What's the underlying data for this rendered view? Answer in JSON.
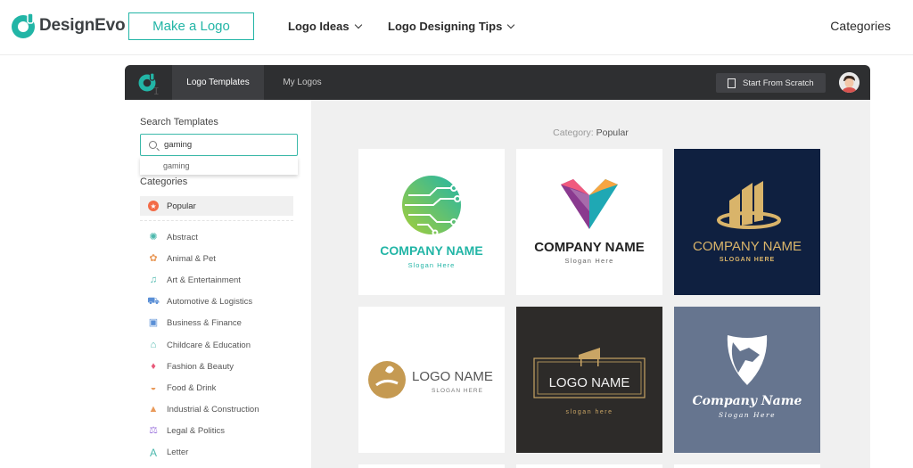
{
  "site": {
    "brand_name": "DesignEvo",
    "make_logo_label": "Make a Logo",
    "nav": [
      {
        "label": "Logo Ideas"
      },
      {
        "label": "Logo Designing Tips"
      }
    ],
    "categories_label": "Categories",
    "colors": {
      "accent": "#22b5a6"
    }
  },
  "app": {
    "tabs": [
      {
        "label": "Logo Templates",
        "active": true
      },
      {
        "label": "My Logos",
        "active": false
      }
    ],
    "scratch_label": "Start From Scratch",
    "avatar_icon": "user-avatar"
  },
  "sidebar": {
    "search_title": "Search Templates",
    "search_value": "gaming",
    "suggestion": "gaming",
    "categories_title": "Categories",
    "popular_label": "Popular",
    "categories": [
      {
        "label": "Abstract",
        "icon": "atom-icon"
      },
      {
        "label": "Animal & Pet",
        "icon": "paw-icon"
      },
      {
        "label": "Art & Entertainment",
        "icon": "music-note-icon"
      },
      {
        "label": "Automotive & Logistics",
        "icon": "car-icon"
      },
      {
        "label": "Business & Finance",
        "icon": "briefcase-icon"
      },
      {
        "label": "Childcare & Education",
        "icon": "graduation-cap-icon"
      },
      {
        "label": "Fashion & Beauty",
        "icon": "diamond-icon"
      },
      {
        "label": "Food & Drink",
        "icon": "food-icon"
      },
      {
        "label": "Industrial & Construction",
        "icon": "construction-icon"
      },
      {
        "label": "Legal & Politics",
        "icon": "scales-icon"
      },
      {
        "label": "Letter",
        "icon": "letter-a-icon"
      }
    ]
  },
  "main": {
    "category_prefix": "Category:",
    "category_value": "Popular",
    "templates": [
      {
        "title": "COMPANY NAME",
        "slogan": "Slogan Here",
        "bg": "#ffffff"
      },
      {
        "title": "COMPANY NAME",
        "slogan": "Slogan Here",
        "bg": "#ffffff"
      },
      {
        "title": "COMPANY NAME",
        "slogan": "SLOGAN HERE",
        "bg": "#0f2040"
      },
      {
        "title": "LOGO NAME",
        "slogan": "SLOGAN HERE",
        "bg": "#ffffff"
      },
      {
        "title": "LOGO NAME",
        "slogan": "slogan here",
        "bg": "#2d2b29"
      },
      {
        "title": "Company Name",
        "slogan": "Slogan Here",
        "bg": "#66758f"
      }
    ]
  }
}
